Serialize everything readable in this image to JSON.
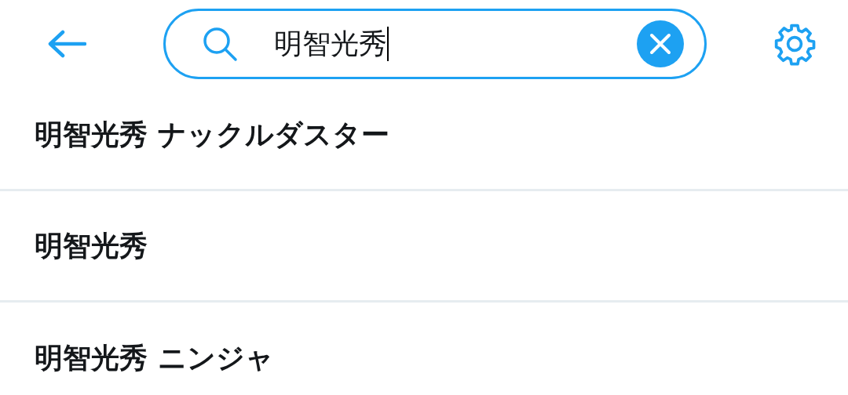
{
  "search": {
    "value": "明智光秀"
  },
  "suggestions": [
    {
      "text": "明智光秀 ナックルダスター"
    },
    {
      "text": "明智光秀"
    },
    {
      "text": "明智光秀 ニンジャ"
    }
  ]
}
